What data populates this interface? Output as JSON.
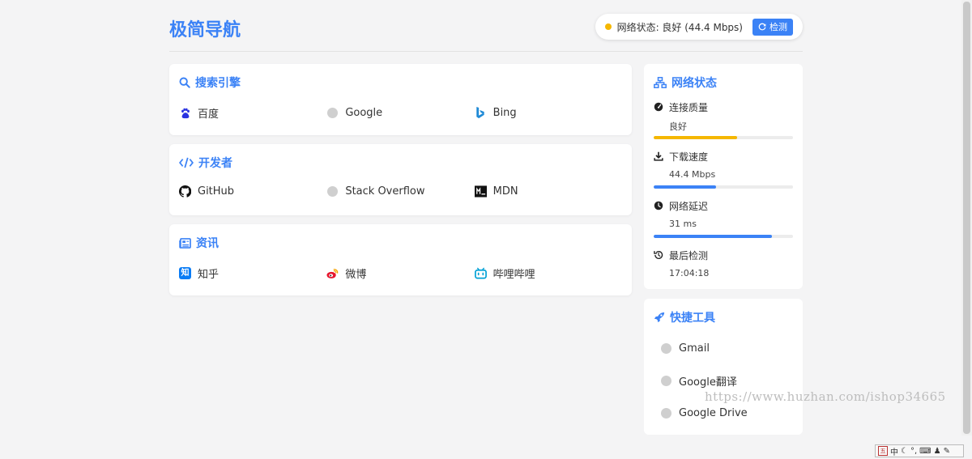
{
  "header": {
    "site_title": "极简导航",
    "network_status_text": "网络状态: 良好 (44.4 Mbps)",
    "detect_label": "检测",
    "status_color": "#f5b700"
  },
  "colors": {
    "accent": "#3b82f6",
    "warning": "#f5b700"
  },
  "sections": [
    {
      "title": "搜索引擎",
      "icon": "search-icon",
      "links": [
        {
          "label": "百度",
          "icon": "baidu-icon"
        },
        {
          "label": "Google",
          "icon": "google-icon"
        },
        {
          "label": "Bing",
          "icon": "bing-icon"
        }
      ]
    },
    {
      "title": "开发者",
      "icon": "code-icon",
      "links": [
        {
          "label": "GitHub",
          "icon": "github-icon"
        },
        {
          "label": "Stack Overflow",
          "icon": "stackoverflow-icon"
        },
        {
          "label": "MDN",
          "icon": "mdn-icon"
        }
      ]
    },
    {
      "title": "资讯",
      "icon": "newspaper-icon",
      "links": [
        {
          "label": "知乎",
          "icon": "zhihu-icon"
        },
        {
          "label": "微博",
          "icon": "weibo-icon"
        },
        {
          "label": "哔哩哔哩",
          "icon": "bilibili-icon"
        }
      ]
    }
  ],
  "network": {
    "title": "网络状态",
    "quality": {
      "label": "连接质量",
      "value": "良好",
      "level": 0.6,
      "color": "#f5b700"
    },
    "download": {
      "label": "下载速度",
      "value": "44.4 Mbps",
      "level": 0.45,
      "color": "#3b82f6"
    },
    "latency": {
      "label": "网络延迟",
      "value": "31 ms",
      "level": 0.85,
      "color": "#3b82f6"
    },
    "last_check": {
      "label": "最后检测",
      "value": "17:04:18"
    }
  },
  "tools": {
    "title": "快捷工具",
    "items": [
      {
        "label": "Gmail"
      },
      {
        "label": "Google翻译"
      },
      {
        "label": "Google Drive"
      }
    ]
  },
  "watermark": "https://www.huzhan.com/ishop34665",
  "tray": {
    "ime_label": "中"
  }
}
